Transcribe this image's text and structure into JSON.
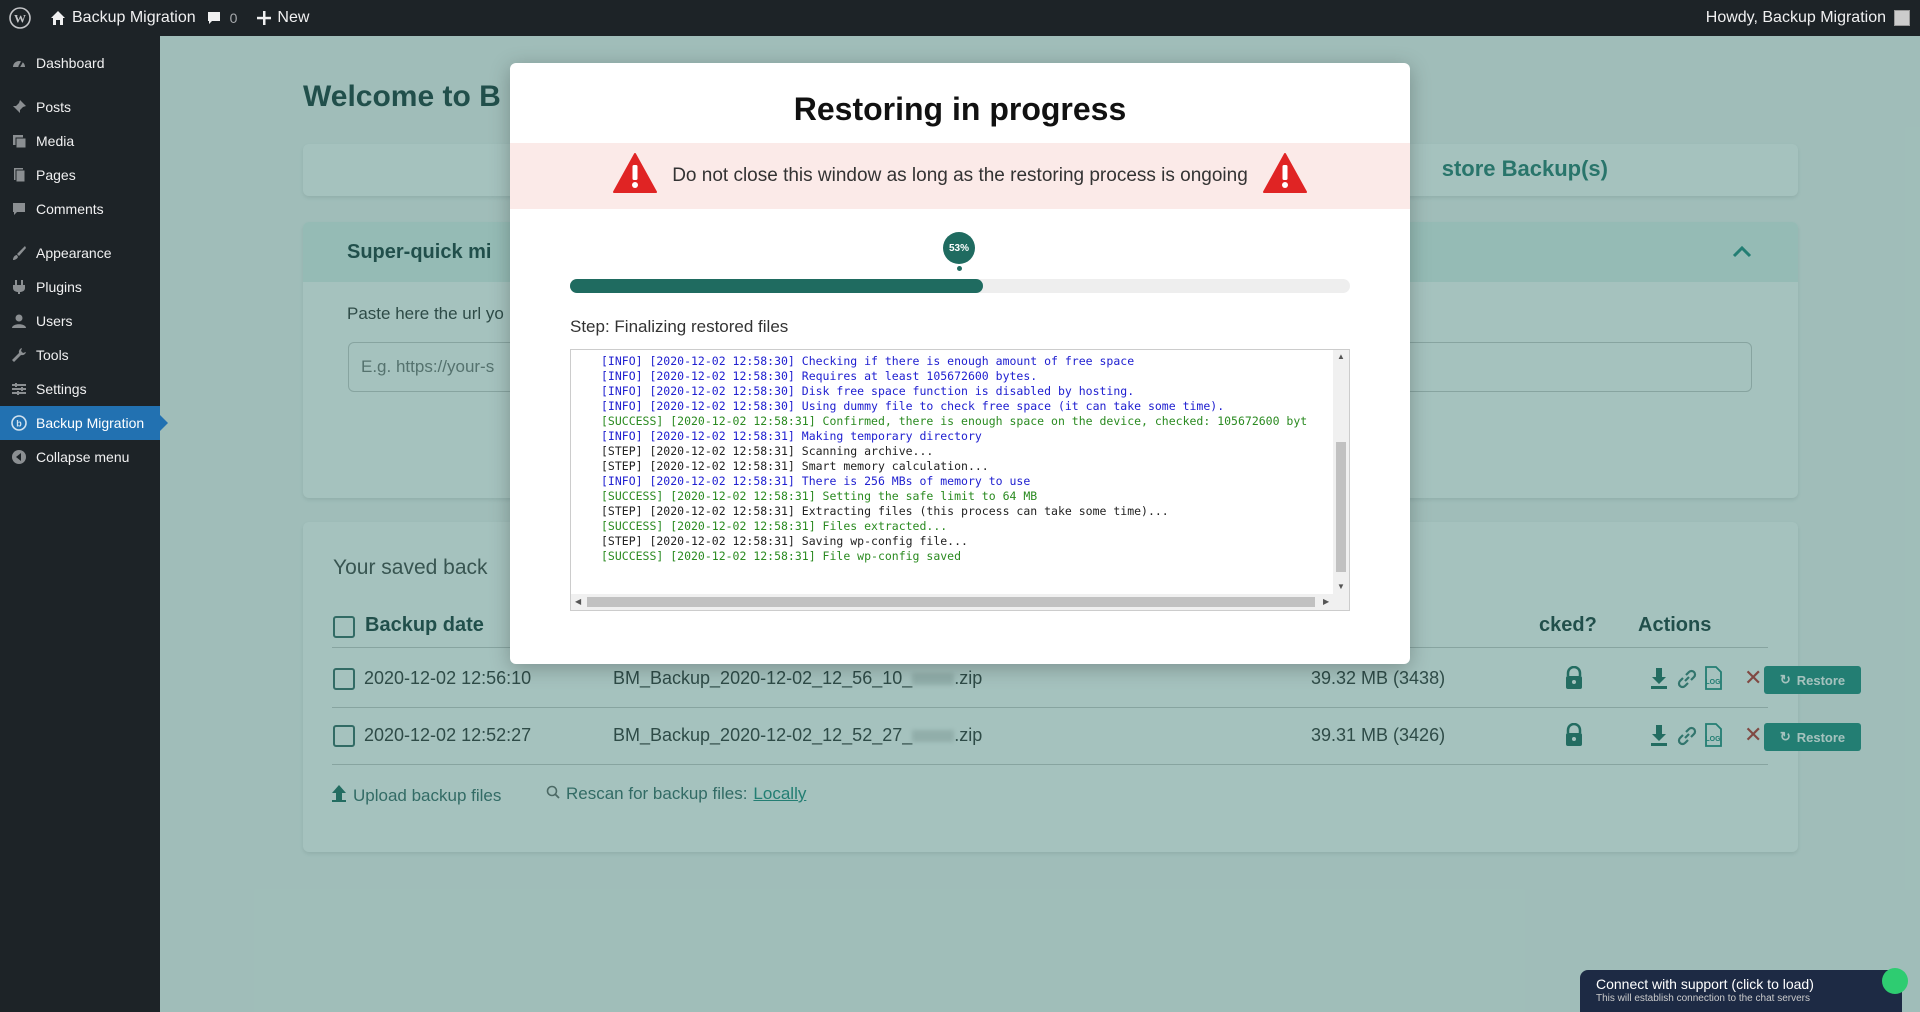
{
  "admin_bar": {
    "site_name": "Backup Migration",
    "comments_count": "0",
    "new_label": "New",
    "howdy": "Howdy, Backup Migration"
  },
  "sidebar": {
    "items": [
      {
        "label": "Dashboard",
        "icon": "dashboard-icon"
      },
      {
        "label": "Posts",
        "icon": "pin-icon"
      },
      {
        "label": "Media",
        "icon": "media-icon"
      },
      {
        "label": "Pages",
        "icon": "pages-icon"
      },
      {
        "label": "Comments",
        "icon": "comment-icon"
      },
      {
        "label": "Appearance",
        "icon": "brush-icon"
      },
      {
        "label": "Plugins",
        "icon": "plug-icon"
      },
      {
        "label": "Users",
        "icon": "user-icon"
      },
      {
        "label": "Tools",
        "icon": "wrench-icon"
      },
      {
        "label": "Settings",
        "icon": "settings-icon"
      },
      {
        "label": "Backup Migration",
        "icon": "backup-icon"
      },
      {
        "label": "Collapse menu",
        "icon": "collapse-icon"
      }
    ]
  },
  "page": {
    "welcome": "Welcome to B",
    "tab_restore": "store Backup(s)",
    "migration_title": "Super-quick mi",
    "migration_label": "Paste here the url yo",
    "migration_placeholder": "E.g. https://your-s",
    "backups_title": "Your saved back",
    "columns": {
      "backup_date": "Backup date",
      "locked": "cked?",
      "actions": "Actions"
    },
    "rows": [
      {
        "date": "2020-12-02 12:56:10",
        "file": "BM_Backup_2020-12-02_12_56_10_",
        "file_ext": ".zip",
        "size": "39.32 MB (3438)"
      },
      {
        "date": "2020-12-02 12:52:27",
        "file": "BM_Backup_2020-12-02_12_52_27_",
        "file_ext": ".zip",
        "size": "39.31 MB (3426)"
      }
    ],
    "restore_label": "Restore",
    "upload_label": "Upload backup files",
    "rescan_label": "Rescan for backup files:",
    "rescan_link": "Locally"
  },
  "modal": {
    "title": "Restoring in progress",
    "warning": "Do not close this window as long as the restoring process is ongoing",
    "progress_percent": 53,
    "progress_label": "53%",
    "step": "Step: Finalizing restored files",
    "log": [
      {
        "type": "info",
        "text": "[INFO] [2020-12-02 12:58:30] Checking if there is enough amount of free space"
      },
      {
        "type": "info",
        "text": "[INFO] [2020-12-02 12:58:30] Requires at least 105672600 bytes."
      },
      {
        "type": "info",
        "text": "[INFO] [2020-12-02 12:58:30] Disk free space function is disabled by hosting."
      },
      {
        "type": "info",
        "text": "[INFO] [2020-12-02 12:58:30] Using dummy file to check free space (it can take some time)."
      },
      {
        "type": "success",
        "text": "[SUCCESS] [2020-12-02 12:58:31] Confirmed, there is enough space on the device, checked: 105672600 byt"
      },
      {
        "type": "info",
        "text": "[INFO] [2020-12-02 12:58:31] Making temporary directory"
      },
      {
        "type": "step",
        "text": "[STEP] [2020-12-02 12:58:31] Scanning archive..."
      },
      {
        "type": "step",
        "text": "[STEP] [2020-12-02 12:58:31] Smart memory calculation..."
      },
      {
        "type": "info",
        "text": "[INFO] [2020-12-02 12:58:31] There is 256 MBs of memory to use"
      },
      {
        "type": "success",
        "text": "[SUCCESS] [2020-12-02 12:58:31] Setting the safe limit to 64 MB"
      },
      {
        "type": "step",
        "text": "[STEP] [2020-12-02 12:58:31] Extracting files (this process can take some time)..."
      },
      {
        "type": "success",
        "text": "[SUCCESS] [2020-12-02 12:58:31] Files extracted..."
      },
      {
        "type": "step",
        "text": "[STEP] [2020-12-02 12:58:31] Saving wp-config file..."
      },
      {
        "type": "success",
        "text": "[SUCCESS] [2020-12-02 12:58:31] File wp-config saved"
      }
    ]
  },
  "chat": {
    "title": "Connect with support (click to load)",
    "subtitle": "This will establish connection to the chat servers"
  },
  "colors": {
    "accent": "#1f6b60",
    "button": "#1f8a7e",
    "danger": "#c0302b",
    "info_log": "#2020d0",
    "success_log": "#2a8a20"
  }
}
